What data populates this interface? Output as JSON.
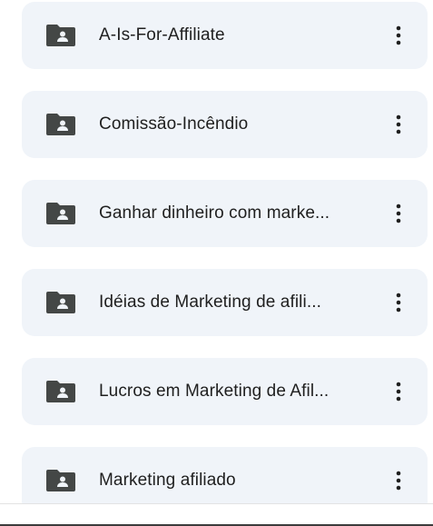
{
  "folders": [
    {
      "name": "A-Is-For-Affiliate",
      "icon": "shared-folder-icon"
    },
    {
      "name": "Comissão-Incêndio",
      "icon": "shared-folder-icon"
    },
    {
      "name": "Ganhar dinheiro com marke...",
      "icon": "shared-folder-icon"
    },
    {
      "name": "Idéias de Marketing de afili...",
      "icon": "shared-folder-icon"
    },
    {
      "name": "Lucros em Marketing de Afil...",
      "icon": "shared-folder-icon"
    },
    {
      "name": "Marketing afiliado",
      "icon": "shared-folder-icon"
    }
  ],
  "colors": {
    "card_bg": "#f0f4f9",
    "icon": "#444746",
    "text": "#1f1f1f"
  }
}
